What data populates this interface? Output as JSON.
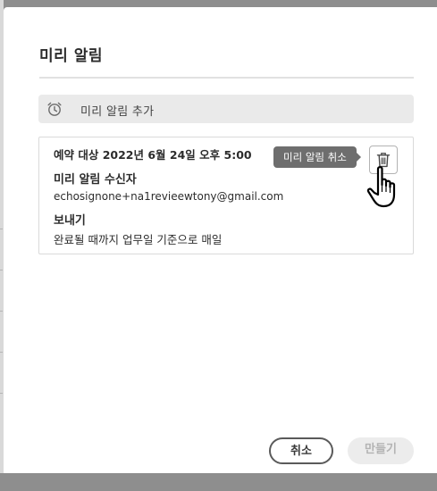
{
  "dialog": {
    "title": "미리 알림",
    "add_reminder_label": "미리 알림 추가",
    "reminder": {
      "scheduled": "예약 대상 2022년 6월 24일 오후 5:00",
      "recipient_heading": "미리 알림 수신자",
      "recipient_email": "echosignone+na1revieewtony@gmail.com",
      "send_heading": "보내기",
      "send_value": "완료될 때까지 업무일 기준으로 매일",
      "delete_tooltip": "미리 알림 취소"
    },
    "buttons": {
      "cancel": "취소",
      "create": "만들기"
    }
  },
  "icons": {
    "add": "alarm-clock-icon",
    "delete": "trash-icon",
    "cursor": "hand-pointer-cursor"
  },
  "colors": {
    "overlay": "#8e8e8e",
    "tooltip_bg": "#6e6e6e",
    "add_bar_bg": "#eaeaea",
    "disabled_button_bg": "#ececec",
    "disabled_button_text": "#b3b3b3"
  }
}
